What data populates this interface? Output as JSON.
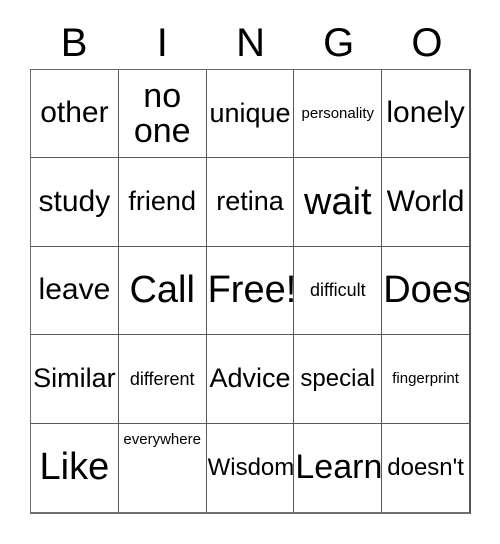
{
  "card": {
    "title_letters": [
      "B",
      "I",
      "N",
      "G",
      "O"
    ],
    "grid": {
      "rows": 5,
      "columns": 5,
      "cells": [
        [
          {
            "text": "other",
            "size": "fs-xl",
            "align": "va-center"
          },
          {
            "text": "no one",
            "size": "fs-2xl",
            "align": "va-center"
          },
          {
            "text": "unique",
            "size": "fs-lg",
            "align": "va-center"
          },
          {
            "text": "personality",
            "size": "fs-xs",
            "align": "va-center"
          },
          {
            "text": "lonely",
            "size": "fs-xl",
            "align": "va-center"
          }
        ],
        [
          {
            "text": "study",
            "size": "fs-xl",
            "align": "va-center"
          },
          {
            "text": "friend",
            "size": "fs-lg",
            "align": "va-center"
          },
          {
            "text": "retina",
            "size": "fs-lg",
            "align": "va-center"
          },
          {
            "text": "wait",
            "size": "fs-3xl",
            "align": "va-center"
          },
          {
            "text": "World",
            "size": "fs-xl",
            "align": "va-center"
          }
        ],
        [
          {
            "text": "leave",
            "size": "fs-xl",
            "align": "va-center"
          },
          {
            "text": "Call",
            "size": "fs-3xl",
            "align": "va-center"
          },
          {
            "text": "Free!",
            "size": "fs-3xl",
            "align": "va-center"
          },
          {
            "text": "difficult",
            "size": "fs-sm",
            "align": "va-center"
          },
          {
            "text": "Does",
            "size": "fs-3xl",
            "align": "va-center"
          }
        ],
        [
          {
            "text": "Similar",
            "size": "fs-lg",
            "align": "va-center"
          },
          {
            "text": "different",
            "size": "fs-sm",
            "align": "va-center"
          },
          {
            "text": "Advice",
            "size": "fs-lg",
            "align": "va-center"
          },
          {
            "text": "special",
            "size": "fs-md",
            "align": "va-center"
          },
          {
            "text": "fingerprint",
            "size": "fs-xs",
            "align": "va-center"
          }
        ],
        [
          {
            "text": "Like",
            "size": "fs-3xl",
            "align": "va-center"
          },
          {
            "text": "everywhere",
            "size": "fs-xs",
            "align": "va-top"
          },
          {
            "text": "Wisdom",
            "size": "fs-md",
            "align": "va-center"
          },
          {
            "text": "Learn",
            "size": "fs-2xl",
            "align": "va-center"
          },
          {
            "text": "doesn't",
            "size": "fs-md",
            "align": "va-center"
          }
        ]
      ]
    },
    "colors": {
      "background": "#ffffff",
      "text": "#000000",
      "grid_line": "#5a5a5a"
    }
  }
}
